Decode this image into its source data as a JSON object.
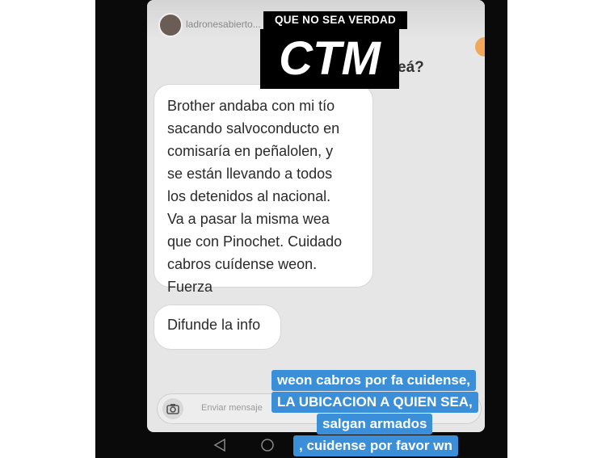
{
  "story": {
    "username": "ladronesabierto...",
    "cover_top": "QUE NO SEA VERDAD",
    "cover_big": "CTM",
    "partial_text": "eá?"
  },
  "messages": [
    {
      "text": "Brother andaba con mi tío\nsacando salvoconducto en\ncomisaría en peñalolen, y\nse están llevando a todos\nlos detenidos al nacional.\n Va a pasar la misma wea\nque con Pinochet.  Cuidado\ncabros cuídense weon.\nFuerza"
    },
    {
      "text": "Difunde la info"
    }
  ],
  "input": {
    "placeholder": "Enviar mensaje"
  },
  "caption": {
    "color": "#3b8fd9",
    "lines": [
      "weon cabros por fa cuidense,",
      "LA UBICACION A QUIEN SEA,",
      "salgan armados",
      ", cuidense por favor wn"
    ]
  },
  "icons": [
    "camera-icon",
    "avatar",
    "back-nav-icon",
    "home-nav-icon",
    "recent-nav-icon"
  ]
}
